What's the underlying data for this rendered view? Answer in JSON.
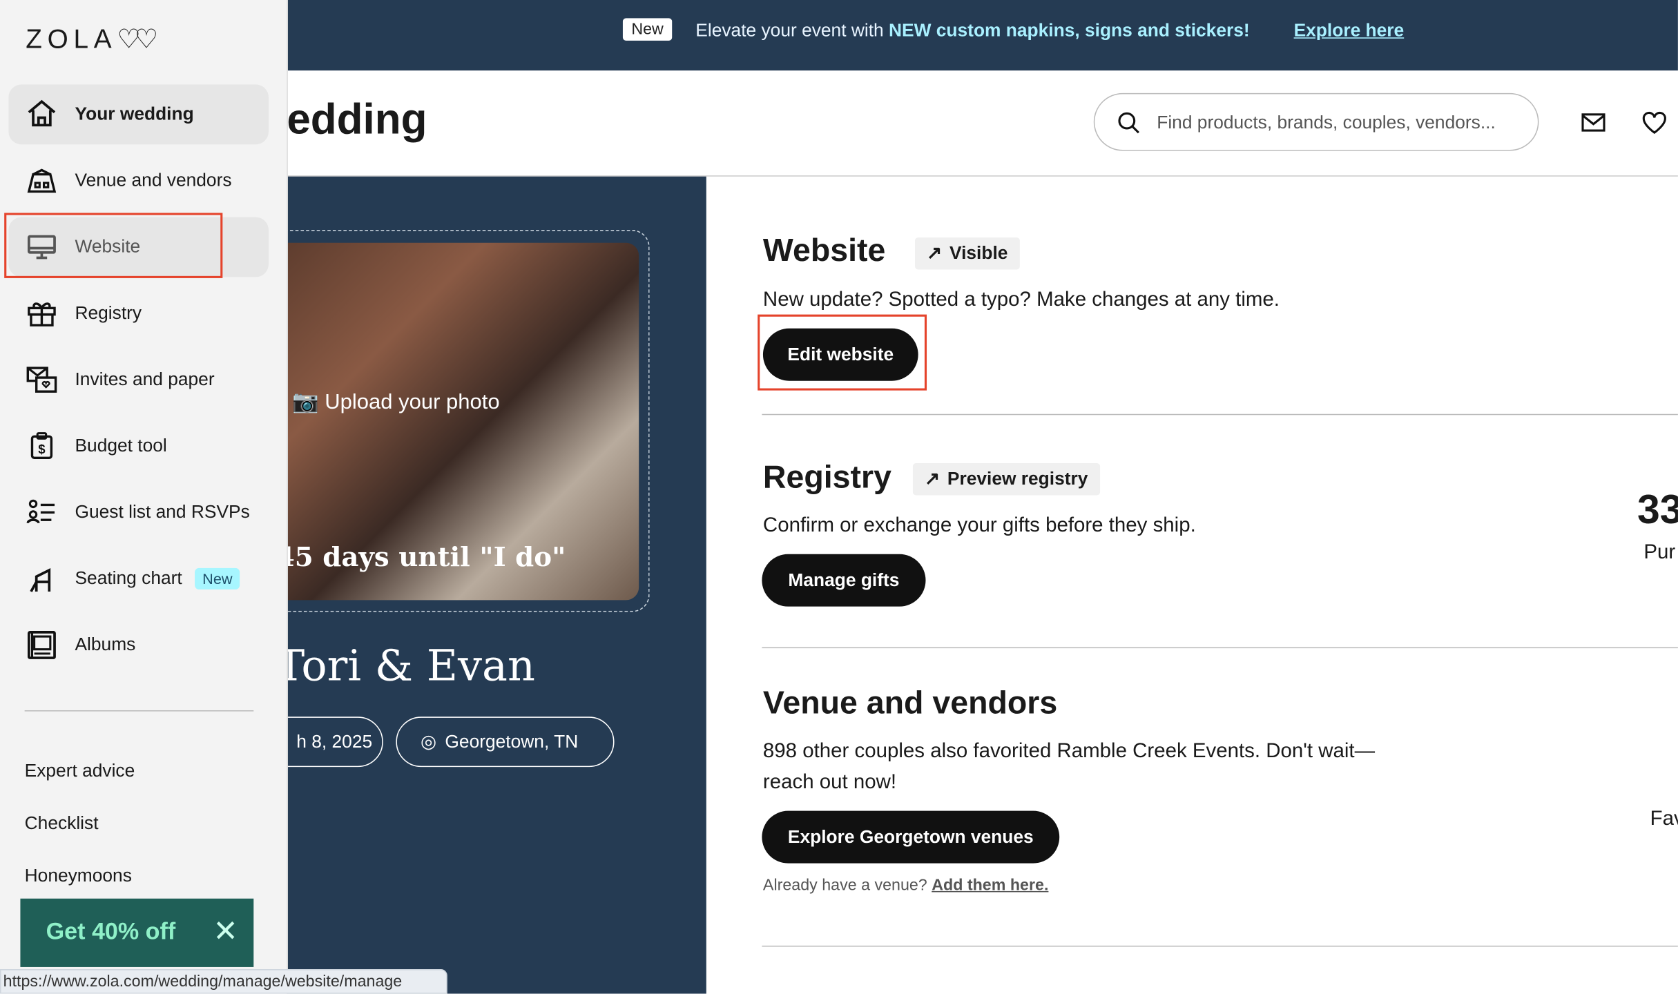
{
  "banner": {
    "badge": "New",
    "message_prefix": "Elevate your event with ",
    "message_bold": "NEW custom napkins, signs and stickers!",
    "link": "Explore here"
  },
  "header": {
    "title": "edding",
    "search_placeholder": "Find products, brands, couples, vendors..."
  },
  "sidebar": {
    "logo": "ZOLA",
    "items": [
      {
        "label": "Your wedding",
        "icon": "home-icon"
      },
      {
        "label": "Venue and vendors",
        "icon": "venue-icon"
      },
      {
        "label": "Website",
        "icon": "monitor-icon"
      },
      {
        "label": "Registry",
        "icon": "gift-icon"
      },
      {
        "label": "Invites and paper",
        "icon": "envelope-icon"
      },
      {
        "label": "Budget tool",
        "icon": "budget-icon"
      },
      {
        "label": "Guest list and RSVPs",
        "icon": "guest-list-icon"
      },
      {
        "label": "Seating chart",
        "icon": "chair-icon",
        "badge": "New"
      },
      {
        "label": "Albums",
        "icon": "album-icon"
      }
    ],
    "links": [
      "Expert advice",
      "Checklist",
      "Honeymoons"
    ],
    "promo": "Get 40% off"
  },
  "hero": {
    "upload": "Upload your photo",
    "countdown": "45 days until \"I do\"",
    "couple": "Tori & Evan",
    "date": "h 8, 2025",
    "location": "Georgetown, TN"
  },
  "website": {
    "title": "Website",
    "tag": "Visible",
    "text": "New update? Spotted a typo? Make changes at any time.",
    "button": "Edit website"
  },
  "registry": {
    "title": "Registry",
    "tag": "Preview registry",
    "text": "Confirm or exchange your gifts before they ship.",
    "button": "Manage gifts",
    "stat": "33",
    "stat_label": "Pur"
  },
  "venue": {
    "title": "Venue and vendors",
    "text1": "898 other couples also favorited Ramble Creek Events. Don't wait—",
    "text2": "reach out now!",
    "button": "Explore Georgetown venues",
    "note": "Already have a venue? ",
    "note_link": "Add them here.",
    "side_label": "Fav"
  },
  "status_url": "https://www.zola.com/wedding/manage/website/manage"
}
